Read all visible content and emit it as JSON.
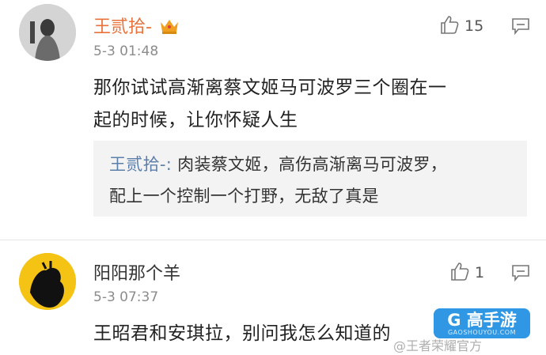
{
  "comments": [
    {
      "username": "王贰拾-",
      "badge_icon": "crown-icon",
      "time": "5-3 01:48",
      "likes": "15",
      "body_lines": [
        "那你试试高渐离蔡文姬马可波罗三个圈在一",
        "起的时候，让你怀疑人生"
      ],
      "reply": {
        "author": "王贰拾-:",
        "lines": [
          "肉装蔡文姬，高伤高渐离马可波罗，",
          "配上一个控制一个打野，无敌了真是"
        ]
      }
    },
    {
      "username": "阳阳那个羊",
      "time": "5-3 07:37",
      "likes": "1",
      "body_lines": [
        "王昭君和安琪拉，别问我怎么知道的"
      ]
    }
  ],
  "watermark": {
    "text": "@王者荣耀官方",
    "logo_main": "G 高手游",
    "logo_sub": "GAOSHOUYOU.COM"
  },
  "colors": {
    "username_orange": "#e8723a",
    "username_dark": "#333333",
    "time_gray": "#8c8c8c",
    "reply_author_blue": "#5b7fab",
    "crown_gold": "#f0a020",
    "logo_blue": "#1e8fe1"
  }
}
